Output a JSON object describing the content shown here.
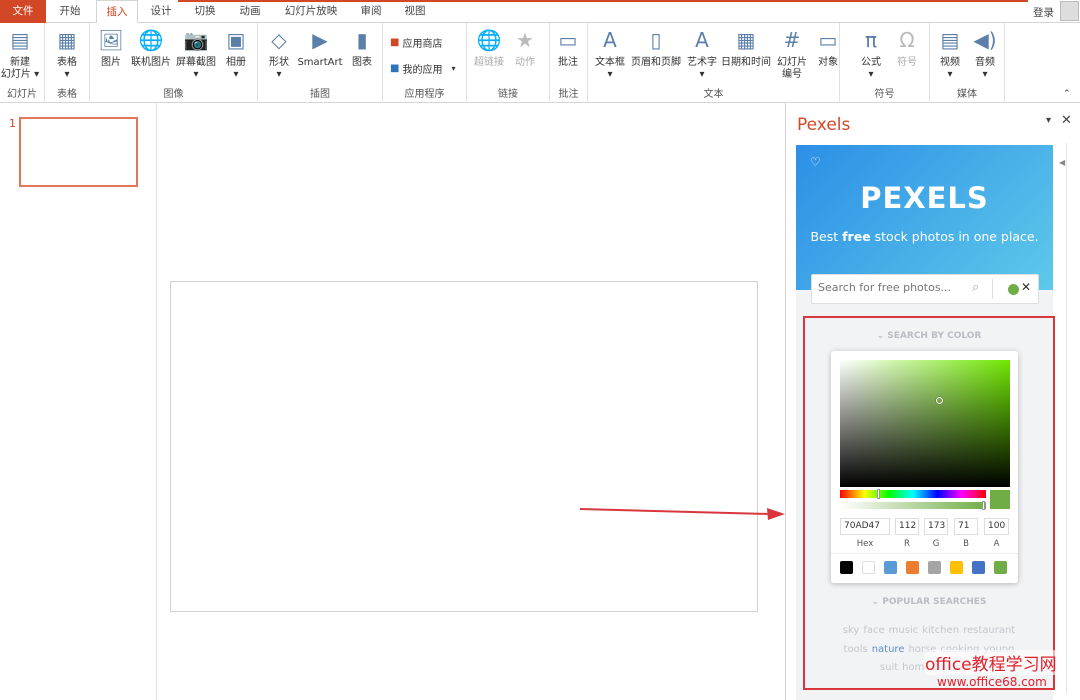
{
  "tabs": [
    "文件",
    "开始",
    "插入",
    "设计",
    "切换",
    "动画",
    "幻灯片放映",
    "审阅",
    "视图"
  ],
  "active_tab": "插入",
  "login": "登录",
  "ribbon": {
    "groups": [
      "幻灯片",
      "表格",
      "图像",
      "插图",
      "应用程序",
      "链接",
      "批注",
      "文本",
      "符号",
      "媒体"
    ],
    "buttons": [
      {
        "label": "新建\n幻灯片 ▾",
        "icon": "new-slide-icon",
        "glyph": "▤"
      },
      {
        "label": "表格\n▾",
        "icon": "table-icon",
        "glyph": "▦"
      },
      {
        "label": "图片",
        "icon": "picture-icon",
        "glyph": "🖼"
      },
      {
        "label": "联机图片",
        "icon": "online-picture-icon",
        "glyph": "🌐"
      },
      {
        "label": "屏幕截图\n▾",
        "icon": "screenshot-icon",
        "glyph": "📷"
      },
      {
        "label": "相册\n▾",
        "icon": "photo-album-icon",
        "glyph": "▣"
      },
      {
        "label": "形状\n▾",
        "icon": "shapes-icon",
        "glyph": "◇"
      },
      {
        "label": "SmartArt",
        "icon": "smartart-icon",
        "glyph": "▶"
      },
      {
        "label": "图表",
        "icon": "chart-icon",
        "glyph": "▮"
      },
      {
        "label": "超链接",
        "icon": "hyperlink-icon",
        "glyph": "🌐",
        "disabled": true
      },
      {
        "label": "动作",
        "icon": "action-icon",
        "glyph": "★",
        "disabled": true
      },
      {
        "label": "批注",
        "icon": "comment-icon",
        "glyph": "▭"
      },
      {
        "label": "文本框\n▾",
        "icon": "textbox-icon",
        "glyph": "A"
      },
      {
        "label": "页眉和页脚",
        "icon": "header-footer-icon",
        "glyph": "▯"
      },
      {
        "label": "艺术字\n▾",
        "icon": "wordart-icon",
        "glyph": "A"
      },
      {
        "label": "日期和时间",
        "icon": "date-time-icon",
        "glyph": "▦"
      },
      {
        "label": "幻灯片\n编号",
        "icon": "slide-number-icon",
        "glyph": "#"
      },
      {
        "label": "对象",
        "icon": "object-icon",
        "glyph": "▭"
      },
      {
        "label": "公式\n▾",
        "icon": "equation-icon",
        "glyph": "π"
      },
      {
        "label": "符号",
        "icon": "symbol-icon",
        "glyph": "Ω",
        "disabled": true
      },
      {
        "label": "视频\n▾",
        "icon": "video-icon",
        "glyph": "▤"
      },
      {
        "label": "音频\n▾",
        "icon": "audio-icon",
        "glyph": "◀)"
      }
    ],
    "app_store": "应用商店",
    "my_apps": "我的应用"
  },
  "thumbnail_number": "1",
  "pexels": {
    "pane_title": "Pexels",
    "logo": "PEXELS",
    "tagline_pre": "Best ",
    "tagline_bold": "free",
    "tagline_post": " stock photos in one place.",
    "search_placeholder": "Search for free photos...",
    "search_by_color": "SEARCH BY COLOR",
    "selected_color": "#70AD47",
    "picker": {
      "hex": "70AD47",
      "r": "112",
      "g": "173",
      "b": "71",
      "a": "100",
      "labels": [
        "Hex",
        "R",
        "G",
        "B",
        "A"
      ]
    },
    "swatches": [
      "#000000",
      "#ffffff",
      "#5b9bd5",
      "#ed7d31",
      "#a5a5a5",
      "#ffc000",
      "#4472c4",
      "#70ad47"
    ],
    "popular_searches": "POPULAR SEARCHES",
    "tags": [
      "sky",
      "face",
      "music",
      "kitchen",
      "restaurant",
      "tools",
      "nature",
      "horse",
      "cooking",
      "young",
      "suit",
      "home",
      "business"
    ],
    "highlighted_tag": "nature"
  },
  "watermark": {
    "line1": "office教程学习网",
    "line2": "www.office68.com"
  }
}
